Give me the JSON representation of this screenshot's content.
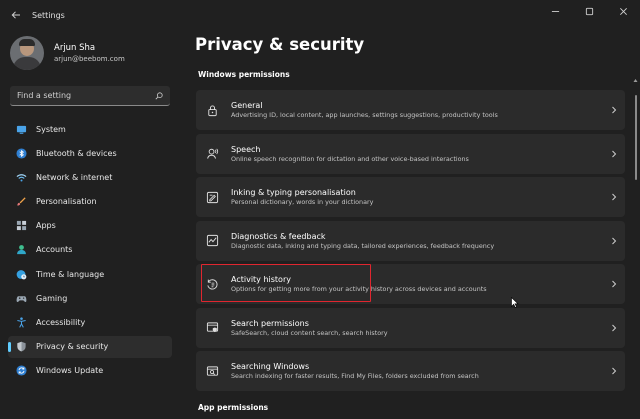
{
  "window": {
    "title": "Settings"
  },
  "user": {
    "name": "Arjun Sha",
    "email": "arjun@beebom.com"
  },
  "search": {
    "placeholder": "Find a setting"
  },
  "sidebar": {
    "items": [
      {
        "label": "System",
        "icon": "monitor-icon"
      },
      {
        "label": "Bluetooth & devices",
        "icon": "bluetooth-icon"
      },
      {
        "label": "Network & internet",
        "icon": "wifi-icon"
      },
      {
        "label": "Personalisation",
        "icon": "brush-icon"
      },
      {
        "label": "Apps",
        "icon": "apps-icon"
      },
      {
        "label": "Accounts",
        "icon": "person-icon"
      },
      {
        "label": "Time & language",
        "icon": "globe-clock-icon"
      },
      {
        "label": "Gaming",
        "icon": "gamepad-icon"
      },
      {
        "label": "Accessibility",
        "icon": "accessibility-icon"
      },
      {
        "label": "Privacy & security",
        "icon": "shield-icon",
        "active": true
      },
      {
        "label": "Windows Update",
        "icon": "sync-icon"
      }
    ]
  },
  "main": {
    "title": "Privacy & security",
    "sections": {
      "windows_permissions": "Windows permissions",
      "app_permissions": "App permissions"
    },
    "cards": [
      {
        "title": "General",
        "desc": "Advertising ID, local content, app launches, settings suggestions, productivity tools",
        "icon": "lock-icon"
      },
      {
        "title": "Speech",
        "desc": "Online speech recognition for dictation and other voice-based interactions",
        "icon": "speech-icon"
      },
      {
        "title": "Inking & typing personalisation",
        "desc": "Personal dictionary, words in your dictionary",
        "icon": "inking-icon"
      },
      {
        "title": "Diagnostics & feedback",
        "desc": "Diagnostic data, inking and typing data, tailored experiences, feedback frequency",
        "icon": "diagnostics-icon"
      },
      {
        "title": "Activity history",
        "desc": "Options for getting more from your activity history across devices and accounts",
        "icon": "history-icon"
      },
      {
        "title": "Search permissions",
        "desc": "SafeSearch, cloud content search, search history",
        "icon": "search-permissions-icon"
      },
      {
        "title": "Searching Windows",
        "desc": "Search indexing for faster results, Find My Files, folders excluded from search",
        "icon": "searching-windows-icon"
      }
    ]
  },
  "colors": {
    "background": "#202020",
    "card": "#2b2b2b",
    "accent": "#60cdff",
    "highlight": "#e0262f"
  }
}
